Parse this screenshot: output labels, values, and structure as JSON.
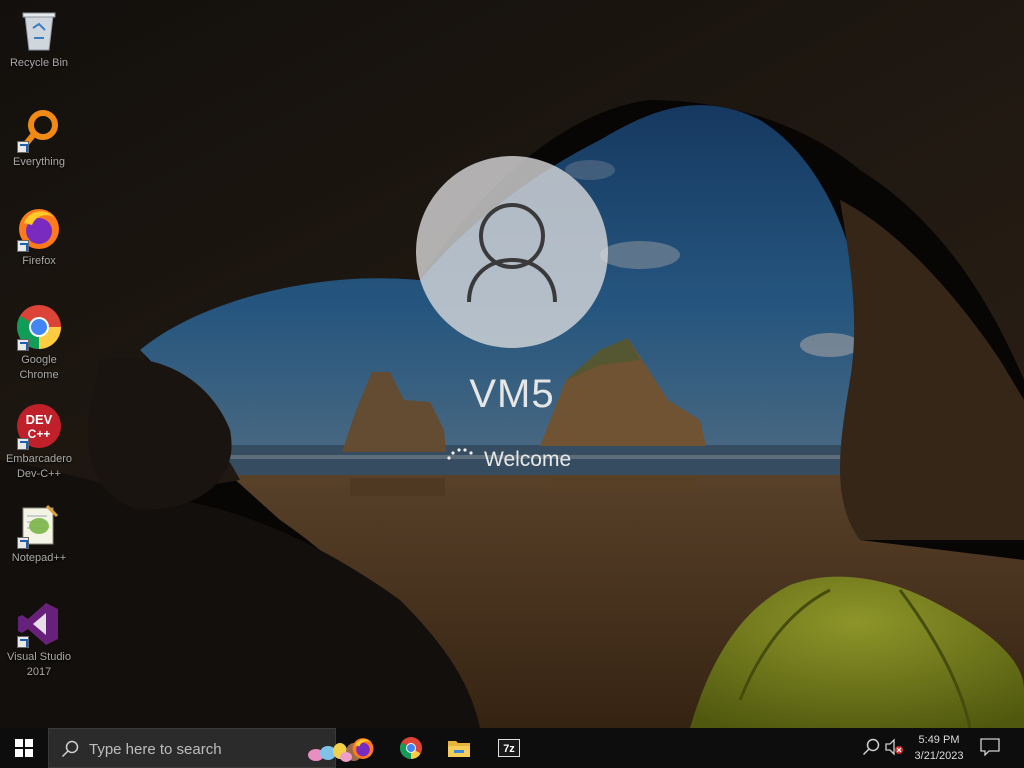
{
  "desktop": {
    "icons": [
      {
        "label": "Recycle Bin",
        "icon": "recycle-bin-icon"
      },
      {
        "label": "Everything",
        "icon": "everything-search-icon"
      },
      {
        "label": "Firefox",
        "icon": "firefox-icon"
      },
      {
        "label": "Google\nChrome",
        "icon": "chrome-icon"
      },
      {
        "label": "Embarcadero\nDev-C++",
        "icon": "devcpp-icon"
      },
      {
        "label": "Notepad++",
        "icon": "notepadpp-icon"
      },
      {
        "label": "Visual Studio\n2017",
        "icon": "visual-studio-icon"
      }
    ]
  },
  "login": {
    "user_name": "VM5",
    "status": "Welcome",
    "avatar_icon": "user-avatar-icon",
    "spinner_icon": "loading-spinner-icon"
  },
  "taskbar": {
    "start_icon": "windows-logo-icon",
    "search": {
      "placeholder": "Type here to search"
    },
    "pinned": [
      {
        "name": "Firefox",
        "icon": "firefox-icon"
      },
      {
        "name": "Google Chrome",
        "icon": "chrome-icon"
      },
      {
        "name": "File Explorer",
        "icon": "folder-icon"
      },
      {
        "name": "7-Zip",
        "icon": "7zip-icon"
      }
    ],
    "clock": {
      "time": "5:49 PM",
      "date": "3/21/2023"
    }
  },
  "colors": {
    "taskbar": "#0d0d0d",
    "search_box": "#2b2b2b",
    "avatar_circle": "#dcdcde",
    "sky": "#2a5f96",
    "sand": "#8a5a30",
    "tent": "#b6c02a"
  }
}
